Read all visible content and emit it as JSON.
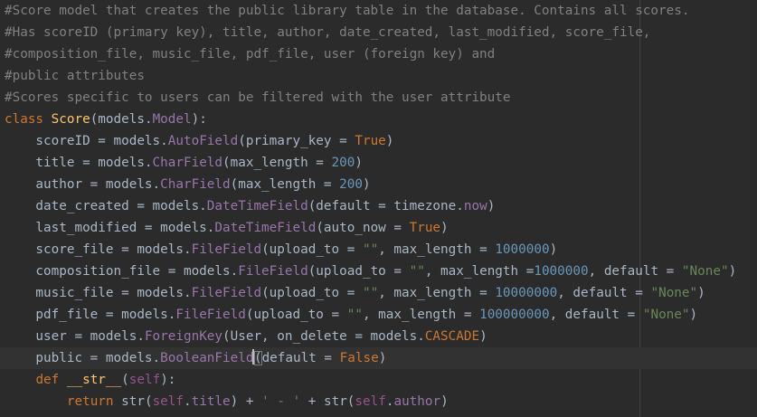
{
  "colors": {
    "background": "#2b2b2b",
    "comment": "#808080",
    "keyword": "#cc7832",
    "class_name": "#ffc66d",
    "text": "#a9b7c6",
    "member": "#9876aa",
    "string": "#6a8759",
    "number": "#6897bb",
    "self": "#94558d"
  },
  "code": {
    "current_line": 16,
    "lines": [
      [
        [
          "cm",
          "#Score model that creates the public library table in the database. Contains all scores."
        ]
      ],
      [
        [
          "cm",
          "#Has scoreID (primary key), title, author, date_created, last_modified, score_file,"
        ]
      ],
      [
        [
          "cm",
          "#composition_file, music_file, pdf_file, user (foreign key) and"
        ]
      ],
      [
        [
          "cm",
          "#public attributes"
        ]
      ],
      [
        [
          "cm",
          "#Scores specific to users can be filtered with the user attribute"
        ]
      ],
      [
        [
          "kw",
          "class "
        ],
        [
          "cls",
          "Score"
        ],
        [
          "tx",
          "(models."
        ],
        [
          "mem",
          "Model"
        ],
        [
          "tx",
          "):"
        ]
      ],
      [
        [
          "tx",
          "    scoreID = models."
        ],
        [
          "mem",
          "AutoField"
        ],
        [
          "tx",
          "(primary_key = "
        ],
        [
          "kw",
          "True"
        ],
        [
          "tx",
          ")"
        ]
      ],
      [
        [
          "tx",
          "    title = models."
        ],
        [
          "mem",
          "CharField"
        ],
        [
          "tx",
          "(max_length = "
        ],
        [
          "num",
          "200"
        ],
        [
          "tx",
          ")"
        ]
      ],
      [
        [
          "tx",
          "    author = models."
        ],
        [
          "mem",
          "CharField"
        ],
        [
          "tx",
          "(max_length = "
        ],
        [
          "num",
          "200"
        ],
        [
          "tx",
          ")"
        ]
      ],
      [
        [
          "tx",
          "    date_created = models."
        ],
        [
          "mem",
          "DateTimeField"
        ],
        [
          "tx",
          "(default = timezone."
        ],
        [
          "mem",
          "now"
        ],
        [
          "tx",
          ")"
        ]
      ],
      [
        [
          "tx",
          "    last_modified = models."
        ],
        [
          "mem",
          "DateTimeField"
        ],
        [
          "tx",
          "(auto_now = "
        ],
        [
          "kw",
          "True"
        ],
        [
          "tx",
          ")"
        ]
      ],
      [
        [
          "tx",
          "    score_file = models."
        ],
        [
          "mem",
          "FileField"
        ],
        [
          "tx",
          "(upload_to = "
        ],
        [
          "str",
          "\"\""
        ],
        [
          "tx",
          ", max_length = "
        ],
        [
          "num",
          "1000000"
        ],
        [
          "tx",
          ")"
        ]
      ],
      [
        [
          "tx",
          "    composition_file = models."
        ],
        [
          "mem",
          "FileField"
        ],
        [
          "tx",
          "(upload_to = "
        ],
        [
          "str",
          "\"\""
        ],
        [
          "tx",
          ", max_length ="
        ],
        [
          "num",
          "1000000"
        ],
        [
          "tx",
          ", default = "
        ],
        [
          "str",
          "\"None\""
        ],
        [
          "tx",
          ")"
        ]
      ],
      [
        [
          "tx",
          "    music_file = models."
        ],
        [
          "mem",
          "FileField"
        ],
        [
          "tx",
          "(upload_to = "
        ],
        [
          "str",
          "\"\""
        ],
        [
          "tx",
          ", max_length = "
        ],
        [
          "num",
          "10000000"
        ],
        [
          "tx",
          ", default = "
        ],
        [
          "str",
          "\"None\""
        ],
        [
          "tx",
          ")"
        ]
      ],
      [
        [
          "tx",
          "    pdf_file = models."
        ],
        [
          "mem",
          "FileField"
        ],
        [
          "tx",
          "(upload_to = "
        ],
        [
          "str",
          "\"\""
        ],
        [
          "tx",
          ", max_length = "
        ],
        [
          "num",
          "100000000"
        ],
        [
          "tx",
          ", default = "
        ],
        [
          "str",
          "\"None\""
        ],
        [
          "tx",
          ")"
        ]
      ],
      [
        [
          "tx",
          "    user = models."
        ],
        [
          "mem",
          "ForeignKey"
        ],
        [
          "tx",
          "(User, on_delete = models."
        ],
        [
          "kw",
          "CASCADE"
        ],
        [
          "tx",
          ")"
        ]
      ],
      [
        [
          "tx",
          "    public = models."
        ],
        [
          "mem",
          "BooleanField"
        ],
        [
          "cursor",
          ""
        ],
        [
          "tx",
          "(default = "
        ],
        [
          "kw",
          "False"
        ],
        [
          "tx",
          ")"
        ]
      ],
      [
        [
          "tx",
          "    "
        ],
        [
          "kw",
          "def "
        ],
        [
          "cls",
          "__str__"
        ],
        [
          "tx",
          "("
        ],
        [
          "self",
          "self"
        ],
        [
          "tx",
          "):"
        ]
      ],
      [
        [
          "tx",
          "        "
        ],
        [
          "kw",
          "return "
        ],
        [
          "tx",
          "str("
        ],
        [
          "self",
          "self"
        ],
        [
          "tx",
          "."
        ],
        [
          "mem",
          "title"
        ],
        [
          "tx",
          ") + "
        ],
        [
          "str",
          "' - '"
        ],
        [
          "tx",
          " + str("
        ],
        [
          "self",
          "self"
        ],
        [
          "tx",
          "."
        ],
        [
          "mem",
          "author"
        ],
        [
          "tx",
          ")"
        ]
      ]
    ]
  }
}
